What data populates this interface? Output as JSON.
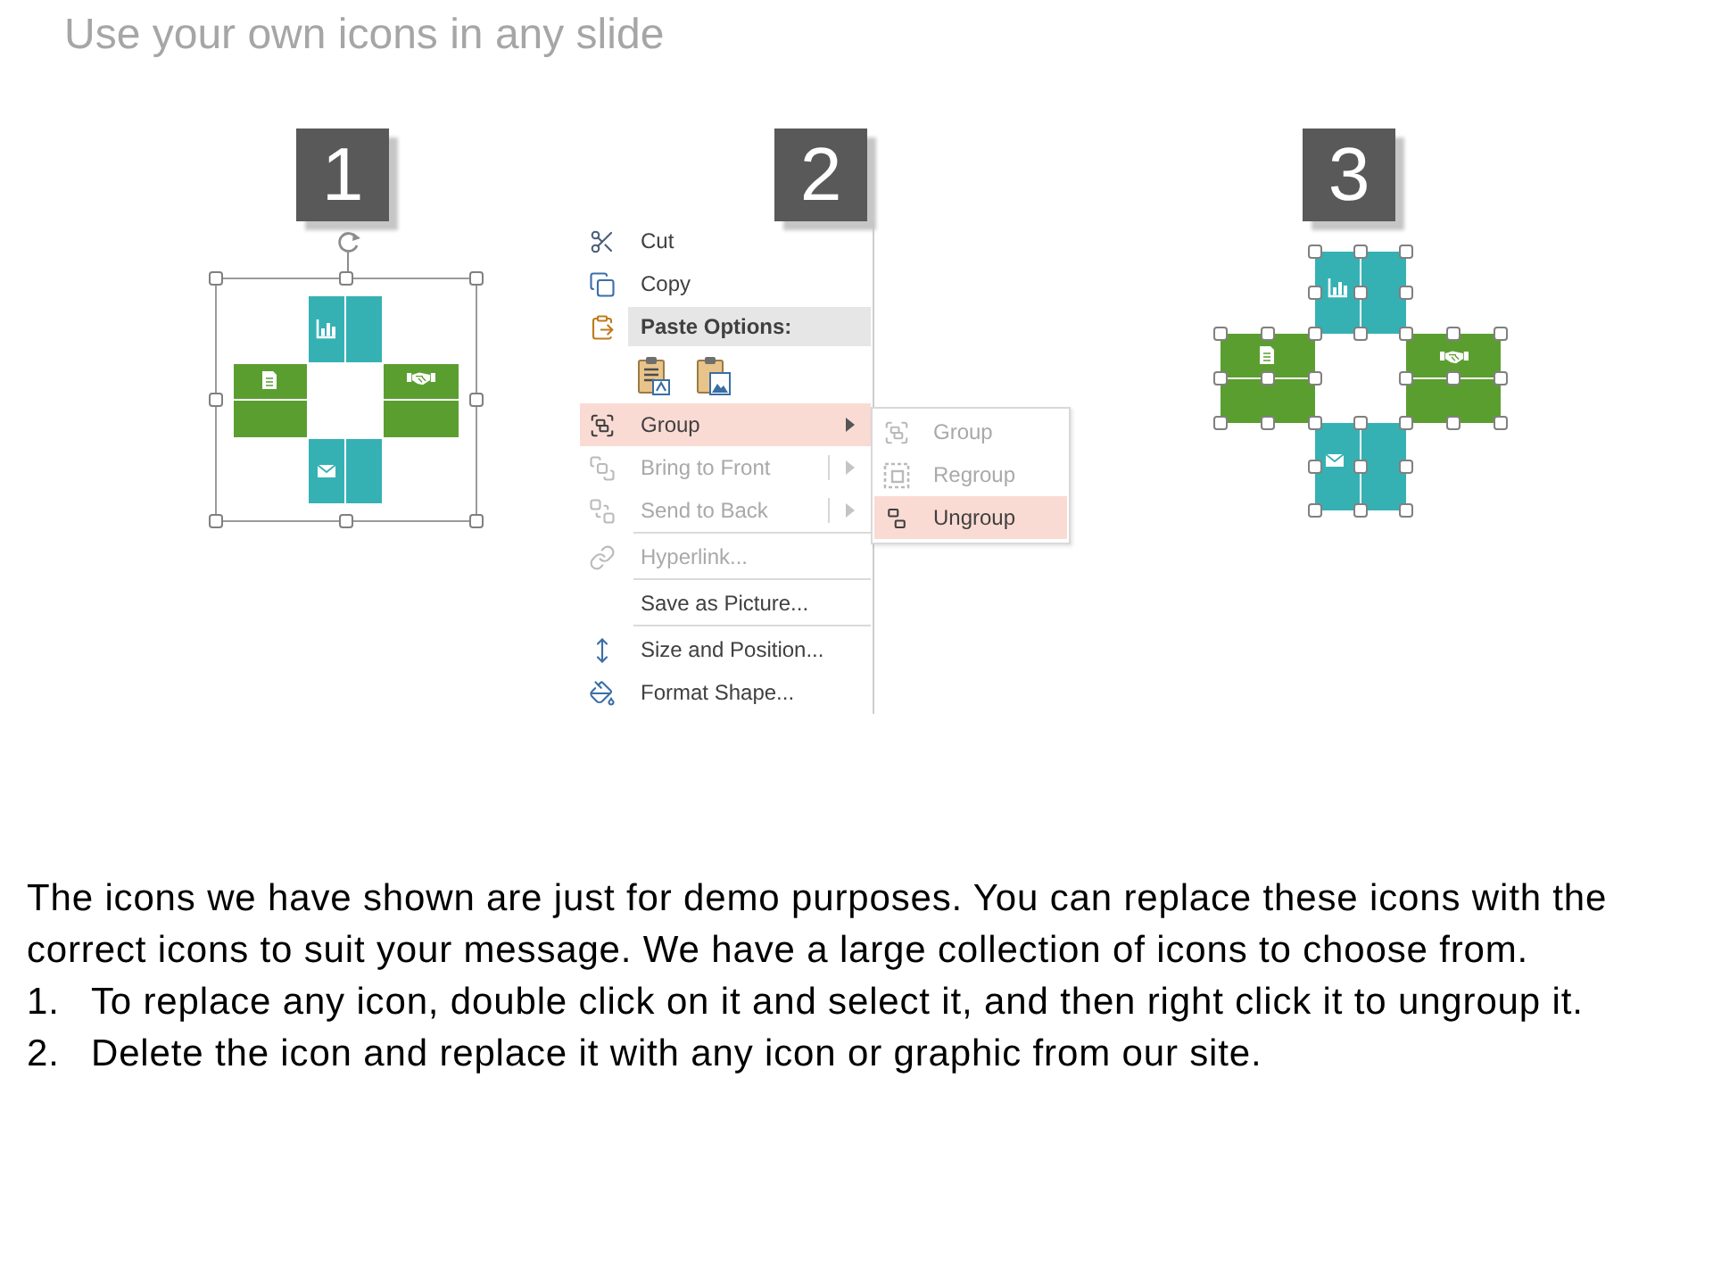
{
  "title": "Use your own icons in any slide",
  "steps": [
    {
      "number": "1",
      "kind": "grouped"
    },
    {
      "number": "2",
      "kind": "context-menu",
      "menu": {
        "items": [
          {
            "kind": "item",
            "label": "Cut",
            "disabled": false,
            "selected": false,
            "submenu": false,
            "divider": false
          },
          {
            "kind": "item",
            "label": "Copy",
            "disabled": false,
            "selected": false,
            "submenu": false,
            "divider": false
          },
          {
            "kind": "header",
            "label": "Paste Options:"
          },
          {
            "kind": "paste-options"
          },
          {
            "kind": "item",
            "label": "Group",
            "disabled": false,
            "selected": true,
            "submenu": true,
            "split": false,
            "divider": false
          },
          {
            "kind": "item",
            "label": "Bring to Front",
            "disabled": true,
            "selected": false,
            "submenu": true,
            "split": true,
            "divider": false
          },
          {
            "kind": "item",
            "label": "Send to Back",
            "disabled": true,
            "selected": false,
            "submenu": true,
            "split": true,
            "divider": false
          },
          {
            "kind": "item",
            "label": "Hyperlink...",
            "disabled": true,
            "selected": false,
            "submenu": false,
            "divider": true
          },
          {
            "kind": "item",
            "label": "Save as Picture...",
            "disabled": false,
            "selected": false,
            "submenu": false,
            "divider": true
          },
          {
            "kind": "item",
            "label": "Size and Position...",
            "disabled": false,
            "selected": false,
            "submenu": false,
            "divider": true
          },
          {
            "kind": "item",
            "label": "Format Shape...",
            "disabled": false,
            "selected": false,
            "submenu": false,
            "divider": false
          }
        ],
        "submenu": {
          "items": [
            {
              "label": "Group",
              "disabled": true,
              "selected": false
            },
            {
              "label": "Regroup",
              "disabled": true,
              "selected": false
            },
            {
              "label": "Ungroup",
              "disabled": false,
              "selected": true
            }
          ]
        }
      }
    },
    {
      "number": "3",
      "kind": "ungrouped"
    }
  ],
  "description": {
    "paragraph": "The icons we have shown are just for demo purposes. You can replace these icons with the correct icons to suit your message. We have a large collection of icons to choose from.",
    "list": [
      {
        "marker": "1.",
        "text": "To replace any icon, double click on it and select it, and then right click it to ungroup it."
      },
      {
        "marker": "2.",
        "text": "Delete the icon and replace it with any icon or graphic from our site."
      }
    ]
  }
}
